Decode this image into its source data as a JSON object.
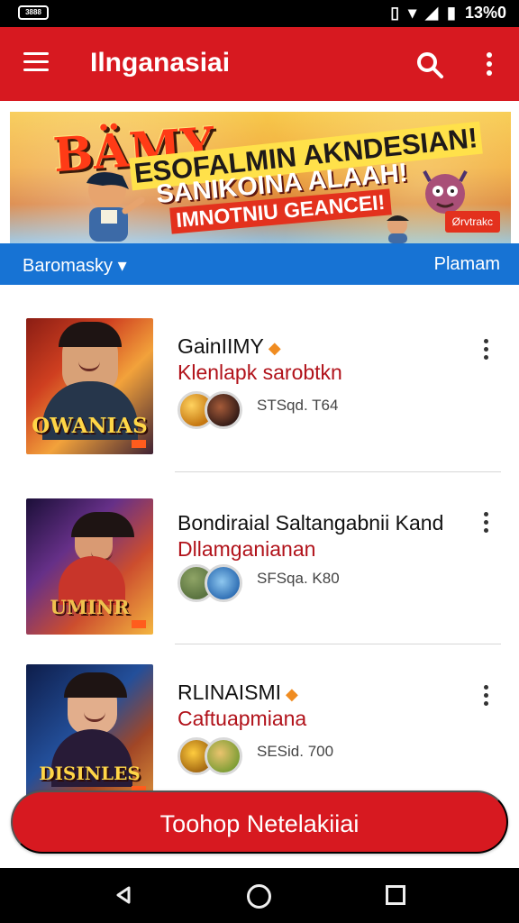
{
  "status": {
    "left": "3888",
    "time": "13%0"
  },
  "appbar": {
    "title": "Ilnganasiai",
    "icons": [
      "menu-icon",
      "search-icon",
      "more-vert-icon"
    ]
  },
  "banner": {
    "line1": "BÄMY",
    "line2": "ESOFALMIN AKNDESIAN!",
    "line3": "SANIKOINA ALAAH!",
    "line4": "IMNOTNIU GEANCEI!",
    "badge": "Ørvtrakc",
    "tab_left": "Baromasky",
    "tab_right": "Plamam"
  },
  "items": [
    {
      "name": "GainIIMY",
      "subtitle": "Klenlapk sarobtkn",
      "meta": "STSqd. T64",
      "thumb_title": "OWANIAS"
    },
    {
      "name": "Bondiraial Saltangabnii Kand",
      "subtitle": "Dllamganianan",
      "meta": "SFSqa. K80",
      "thumb_title": "UMINR"
    },
    {
      "name": "RLINAISMI",
      "subtitle": "Caftuapmiana",
      "meta": "SESid. 700",
      "thumb_title": "DISINLES"
    }
  ],
  "cta": {
    "label": "Toohop Netelakiiai"
  },
  "colors": {
    "primary": "#d71920",
    "accent": "#1773d4"
  }
}
